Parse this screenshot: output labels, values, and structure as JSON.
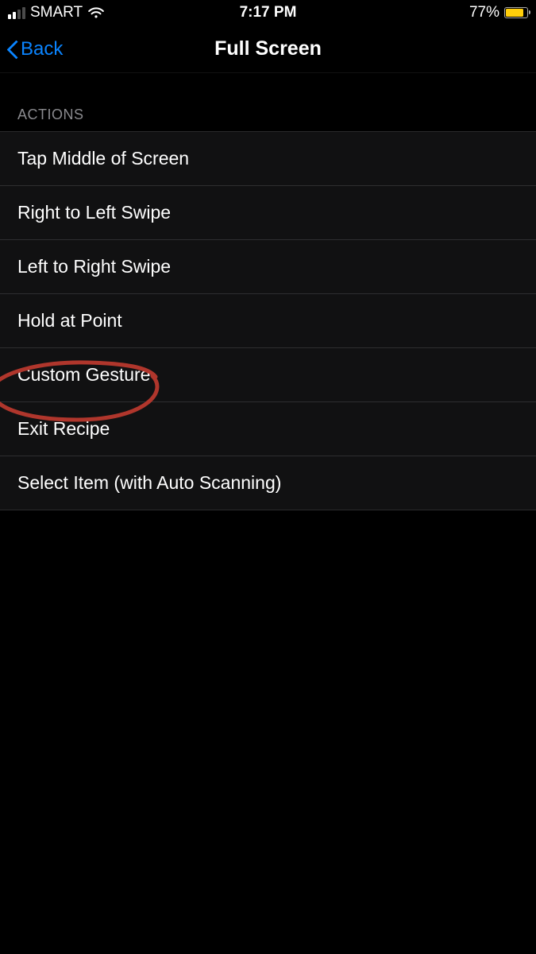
{
  "status": {
    "carrier": "SMART",
    "time": "7:17 PM",
    "battery_percent": "77%"
  },
  "nav": {
    "back_label": "Back",
    "title": "Full Screen"
  },
  "section": {
    "header": "ACTIONS",
    "items": [
      {
        "label": "Tap Middle of Screen"
      },
      {
        "label": "Right to Left Swipe"
      },
      {
        "label": "Left to Right Swipe"
      },
      {
        "label": "Hold at Point"
      },
      {
        "label": "Custom Gesture",
        "annotated": true
      },
      {
        "label": "Exit Recipe"
      },
      {
        "label": "Select Item (with Auto Scanning)"
      }
    ]
  },
  "colors": {
    "accent": "#0a84ff",
    "battery_fill": "#ffce0a",
    "annotation_stroke": "#b0362c"
  }
}
